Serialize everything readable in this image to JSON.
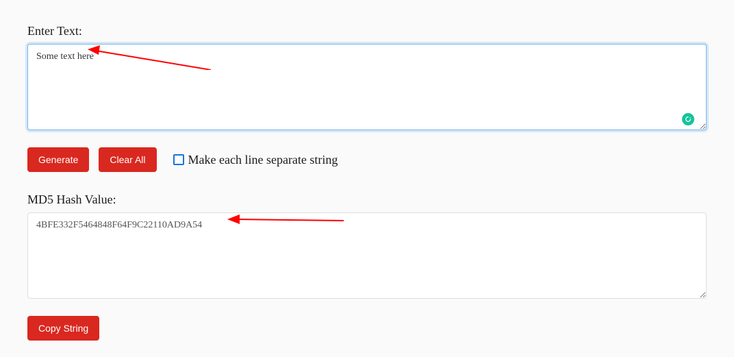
{
  "input": {
    "label": "Enter Text:",
    "value": "Some text here",
    "placeholder": ""
  },
  "buttons": {
    "generate": "Generate",
    "clear": "Clear All",
    "copy": "Copy String"
  },
  "checkbox": {
    "label": "Make each line separate string",
    "checked": false
  },
  "output": {
    "label": "MD5 Hash Value:",
    "value": "4BFE332F5464848F64F9C22110AD9A54"
  },
  "icons": {
    "grammarly": "grammarly-icon"
  },
  "colors": {
    "button_bg": "#d9281f",
    "checkbox_border": "#1a73d9",
    "focus_border": "#7ab8e6",
    "grammarly": "#15c39a",
    "arrow": "#ff0000"
  }
}
